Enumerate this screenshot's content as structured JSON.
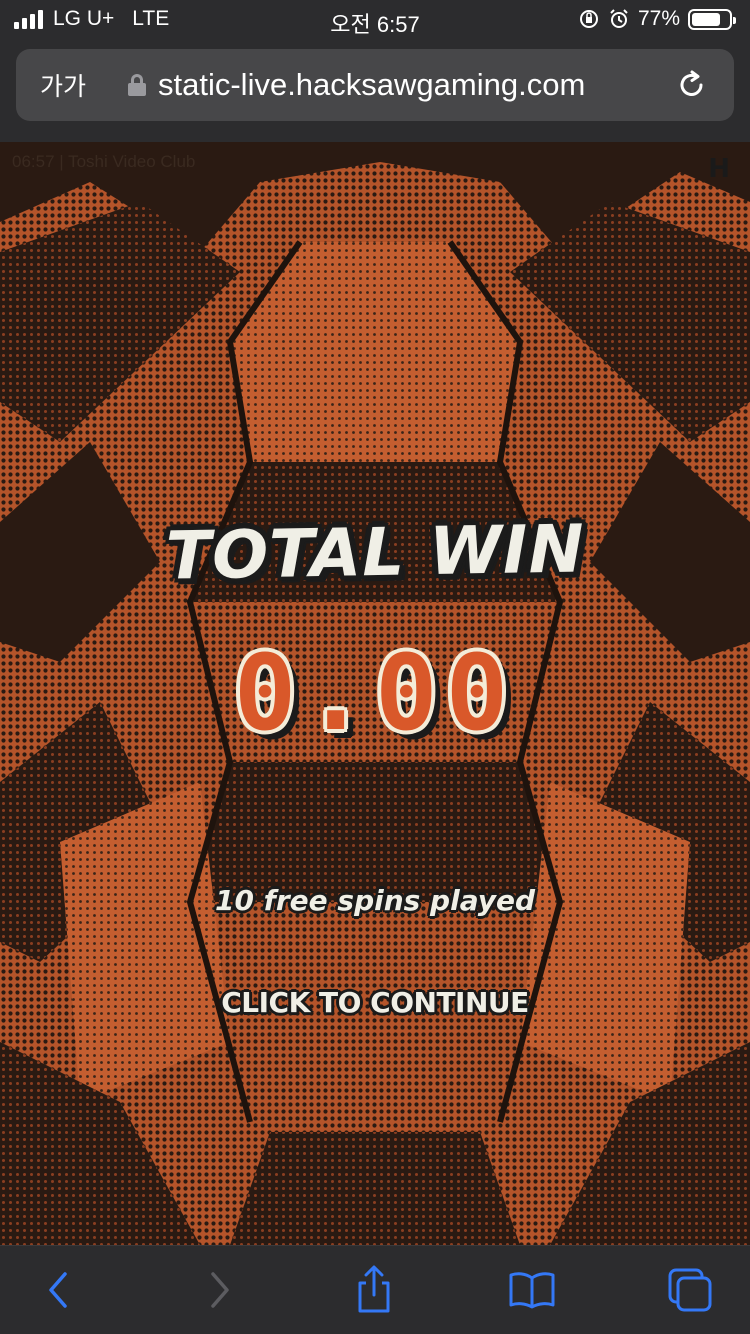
{
  "status_bar": {
    "carrier": "LG U+",
    "network": "LTE",
    "time": "오전 6:57",
    "battery_percent": "77%",
    "battery_level": 0.77
  },
  "browser": {
    "text_size_label": "가가",
    "url": "static-live.hacksawgaming.com"
  },
  "game": {
    "info": "06:57  |  Toshi Video Club",
    "logo": "H",
    "total_win_label": "TOTAL WIN",
    "win_amount": "0.00",
    "spins_played": "10 free spins played",
    "continue_label": "CLICK TO CONTINUE"
  },
  "colors": {
    "accent": "#d9582a",
    "background_dark": "#1b1b1b",
    "ios_blue": "#3478f6"
  },
  "toolbar": {
    "icons": [
      "back-icon",
      "forward-icon",
      "share-icon",
      "bookmarks-icon",
      "tabs-icon"
    ]
  }
}
